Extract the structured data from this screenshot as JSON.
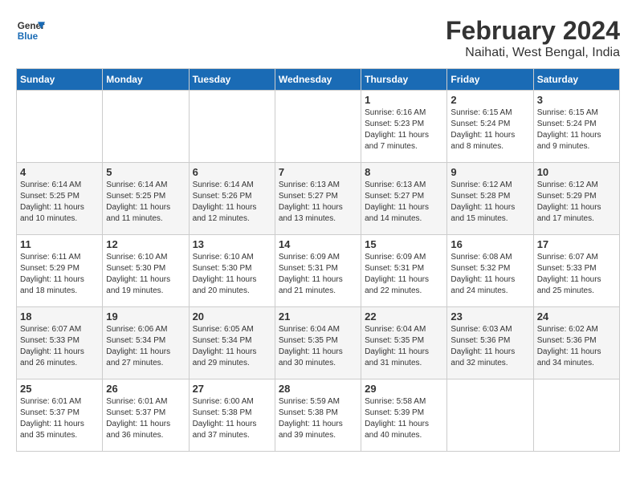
{
  "logo": {
    "line1": "General",
    "line2": "Blue"
  },
  "title": "February 2024",
  "subtitle": "Naihati, West Bengal, India",
  "days_of_week": [
    "Sunday",
    "Monday",
    "Tuesday",
    "Wednesday",
    "Thursday",
    "Friday",
    "Saturday"
  ],
  "weeks": [
    [
      {
        "day": "",
        "info": ""
      },
      {
        "day": "",
        "info": ""
      },
      {
        "day": "",
        "info": ""
      },
      {
        "day": "",
        "info": ""
      },
      {
        "day": "1",
        "info": "Sunrise: 6:16 AM\nSunset: 5:23 PM\nDaylight: 11 hours\nand 7 minutes."
      },
      {
        "day": "2",
        "info": "Sunrise: 6:15 AM\nSunset: 5:24 PM\nDaylight: 11 hours\nand 8 minutes."
      },
      {
        "day": "3",
        "info": "Sunrise: 6:15 AM\nSunset: 5:24 PM\nDaylight: 11 hours\nand 9 minutes."
      }
    ],
    [
      {
        "day": "4",
        "info": "Sunrise: 6:14 AM\nSunset: 5:25 PM\nDaylight: 11 hours\nand 10 minutes."
      },
      {
        "day": "5",
        "info": "Sunrise: 6:14 AM\nSunset: 5:25 PM\nDaylight: 11 hours\nand 11 minutes."
      },
      {
        "day": "6",
        "info": "Sunrise: 6:14 AM\nSunset: 5:26 PM\nDaylight: 11 hours\nand 12 minutes."
      },
      {
        "day": "7",
        "info": "Sunrise: 6:13 AM\nSunset: 5:27 PM\nDaylight: 11 hours\nand 13 minutes."
      },
      {
        "day": "8",
        "info": "Sunrise: 6:13 AM\nSunset: 5:27 PM\nDaylight: 11 hours\nand 14 minutes."
      },
      {
        "day": "9",
        "info": "Sunrise: 6:12 AM\nSunset: 5:28 PM\nDaylight: 11 hours\nand 15 minutes."
      },
      {
        "day": "10",
        "info": "Sunrise: 6:12 AM\nSunset: 5:29 PM\nDaylight: 11 hours\nand 17 minutes."
      }
    ],
    [
      {
        "day": "11",
        "info": "Sunrise: 6:11 AM\nSunset: 5:29 PM\nDaylight: 11 hours\nand 18 minutes."
      },
      {
        "day": "12",
        "info": "Sunrise: 6:10 AM\nSunset: 5:30 PM\nDaylight: 11 hours\nand 19 minutes."
      },
      {
        "day": "13",
        "info": "Sunrise: 6:10 AM\nSunset: 5:30 PM\nDaylight: 11 hours\nand 20 minutes."
      },
      {
        "day": "14",
        "info": "Sunrise: 6:09 AM\nSunset: 5:31 PM\nDaylight: 11 hours\nand 21 minutes."
      },
      {
        "day": "15",
        "info": "Sunrise: 6:09 AM\nSunset: 5:31 PM\nDaylight: 11 hours\nand 22 minutes."
      },
      {
        "day": "16",
        "info": "Sunrise: 6:08 AM\nSunset: 5:32 PM\nDaylight: 11 hours\nand 24 minutes."
      },
      {
        "day": "17",
        "info": "Sunrise: 6:07 AM\nSunset: 5:33 PM\nDaylight: 11 hours\nand 25 minutes."
      }
    ],
    [
      {
        "day": "18",
        "info": "Sunrise: 6:07 AM\nSunset: 5:33 PM\nDaylight: 11 hours\nand 26 minutes."
      },
      {
        "day": "19",
        "info": "Sunrise: 6:06 AM\nSunset: 5:34 PM\nDaylight: 11 hours\nand 27 minutes."
      },
      {
        "day": "20",
        "info": "Sunrise: 6:05 AM\nSunset: 5:34 PM\nDaylight: 11 hours\nand 29 minutes."
      },
      {
        "day": "21",
        "info": "Sunrise: 6:04 AM\nSunset: 5:35 PM\nDaylight: 11 hours\nand 30 minutes."
      },
      {
        "day": "22",
        "info": "Sunrise: 6:04 AM\nSunset: 5:35 PM\nDaylight: 11 hours\nand 31 minutes."
      },
      {
        "day": "23",
        "info": "Sunrise: 6:03 AM\nSunset: 5:36 PM\nDaylight: 11 hours\nand 32 minutes."
      },
      {
        "day": "24",
        "info": "Sunrise: 6:02 AM\nSunset: 5:36 PM\nDaylight: 11 hours\nand 34 minutes."
      }
    ],
    [
      {
        "day": "25",
        "info": "Sunrise: 6:01 AM\nSunset: 5:37 PM\nDaylight: 11 hours\nand 35 minutes."
      },
      {
        "day": "26",
        "info": "Sunrise: 6:01 AM\nSunset: 5:37 PM\nDaylight: 11 hours\nand 36 minutes."
      },
      {
        "day": "27",
        "info": "Sunrise: 6:00 AM\nSunset: 5:38 PM\nDaylight: 11 hours\nand 37 minutes."
      },
      {
        "day": "28",
        "info": "Sunrise: 5:59 AM\nSunset: 5:38 PM\nDaylight: 11 hours\nand 39 minutes."
      },
      {
        "day": "29",
        "info": "Sunrise: 5:58 AM\nSunset: 5:39 PM\nDaylight: 11 hours\nand 40 minutes."
      },
      {
        "day": "",
        "info": ""
      },
      {
        "day": "",
        "info": ""
      }
    ]
  ]
}
